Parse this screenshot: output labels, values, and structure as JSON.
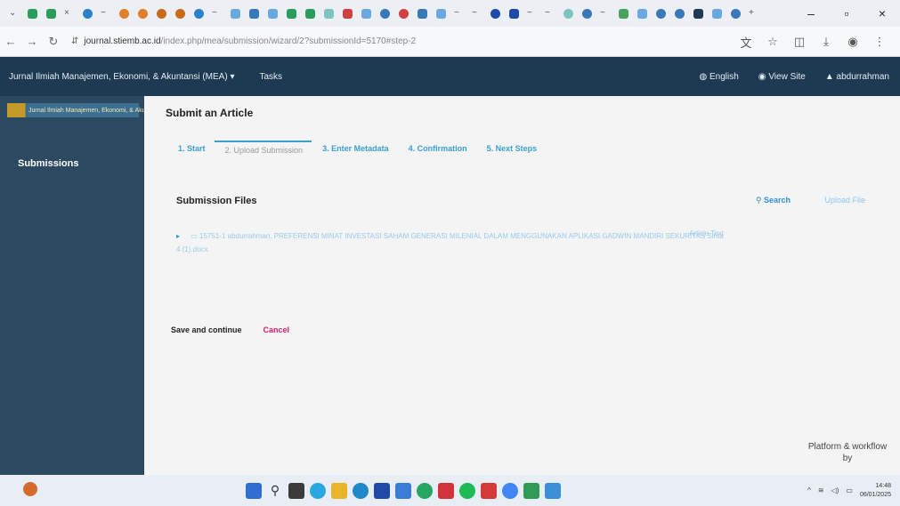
{
  "browser": {
    "url_host": "journal.stiemb.ac.id",
    "url_path": "/index.php/mea/submission/wizard/2?submissionId=5170#step-2",
    "window_controls": {
      "minimize": "–",
      "maximize": "▫",
      "close": "×"
    }
  },
  "topnav": {
    "context": "Jurnal Ilmiah Manajemen, Ekonomi, & Akuntansi (MEA) ▾",
    "tasks": "Tasks",
    "language": "English",
    "view_site": "View Site",
    "user": "abdurrahman"
  },
  "sidebar": {
    "logo_text": "Jurnal Ilmiah Manajemen, Ekonomi, & Akuntansi",
    "items": [
      {
        "label": "Submissions"
      }
    ]
  },
  "main": {
    "title": "Submit an Article",
    "steps": [
      {
        "label": "1. Start"
      },
      {
        "label": "2. Upload Submission"
      },
      {
        "label": "3. Enter Metadata"
      },
      {
        "label": "4. Confirmation"
      },
      {
        "label": "5. Next Steps"
      }
    ],
    "files_panel": {
      "title": "Submission Files",
      "search_label": "Search",
      "upload_label": "Upload File",
      "files": [
        {
          "id": "15751-1",
          "name": "abdurrahman, PREFERENSI MINAT INVESTASI SAHAM GENERASI MILENIAL DALAM MENGGUNAKAN APLIKASI GADWIN MANDIRI SEKURITAS Sinta 4 (1).docx",
          "type": "Article Text"
        }
      ]
    },
    "save_label": "Save and continue",
    "cancel_label": "Cancel",
    "footer": "Platform & workflow by"
  },
  "taskbar": {
    "time": "14:48",
    "date": "06/01/2025"
  }
}
